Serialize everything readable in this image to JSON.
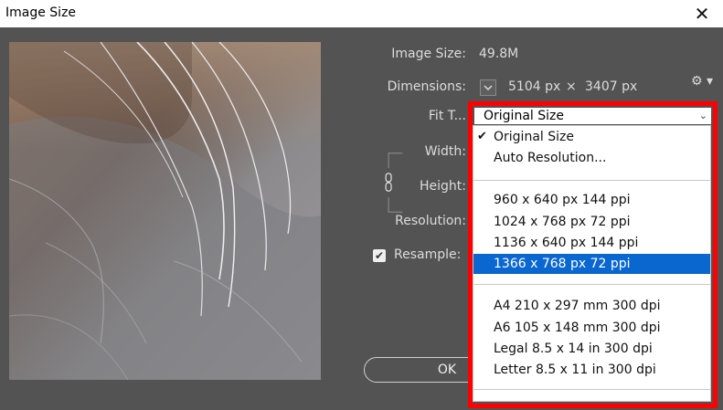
{
  "window": {
    "title": "Image Size",
    "close_glyph": "✕"
  },
  "image_size": {
    "label": "Image Size:",
    "value": "49.8M"
  },
  "dimensions": {
    "label": "Dimensions:",
    "width": "5104 px",
    "times": "×",
    "height": "3407 px"
  },
  "fit_to": {
    "label": "Fit T...",
    "selected": "Original Size"
  },
  "width": {
    "label": "Width:"
  },
  "height": {
    "label": "Height:"
  },
  "resolution": {
    "label": "Resolution:"
  },
  "resample": {
    "label": "Resample:",
    "checked": true
  },
  "ok_button": {
    "label": "OK"
  },
  "menu": {
    "group1": [
      "Original Size",
      "Auto Resolution..."
    ],
    "group2": [
      "960 x 640 px 144 ppi",
      "1024 x 768 px 72 ppi",
      "1136 x 640 px 144 ppi",
      "1366 x 768 px 72 ppi"
    ],
    "group3": [
      "A4 210 x 297 mm 300 dpi",
      "A6 105 x 148 mm 300 dpi",
      "Legal 8.5 x 14 in 300 dpi",
      "Letter 8.5 x 11 in 300 dpi"
    ],
    "checked_item": "Original Size",
    "highlighted_item": "1366 x 768 px 72 ppi"
  },
  "colors": {
    "dialog_bg": "#535353",
    "highlight": "#0a67d0",
    "annotation_frame": "#ff0000"
  },
  "icons": {
    "gear": "gear-icon",
    "link": "link-icon",
    "close": "close-icon",
    "chevron": "chevron-down-icon"
  }
}
